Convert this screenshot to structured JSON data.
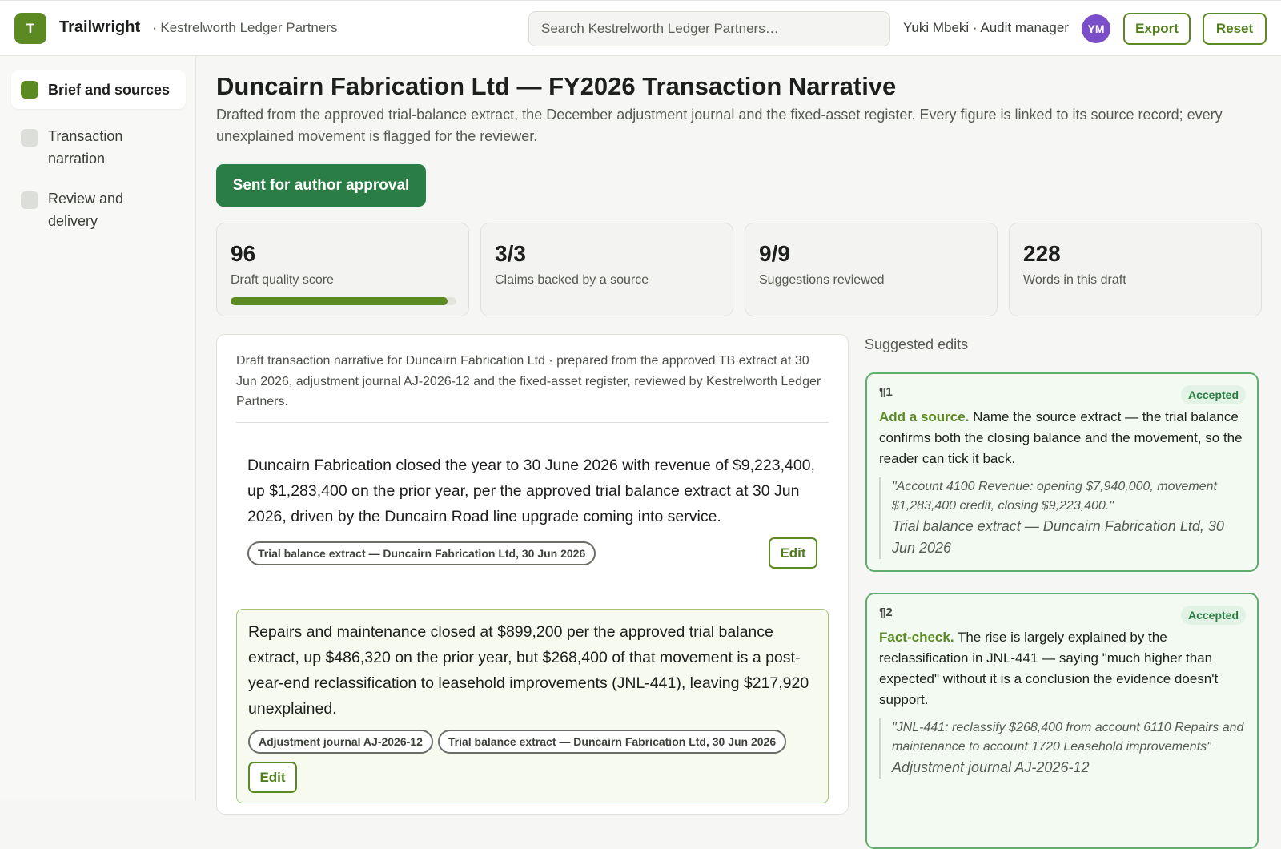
{
  "app": {
    "logo_letter": "T",
    "name": "Trailwright",
    "org": "· Kestrelworth Ledger Partners",
    "search_placeholder": "Search Kestrelworth Ledger Partners…",
    "user": "Yuki Mbeki · Audit manager",
    "avatar_initials": "YM",
    "export_label": "Export",
    "reset_label": "Reset"
  },
  "sidebar": {
    "items": [
      {
        "label": "Brief and sources",
        "active": true
      },
      {
        "label": "Transaction narration",
        "active": false
      },
      {
        "label": "Review and delivery",
        "active": false
      }
    ]
  },
  "page": {
    "title": "Duncairn Fabrication Ltd — FY2026 Transaction Narrative",
    "subtitle": "Drafted from the approved trial-balance extract, the December adjustment journal and the fixed-asset register. Every figure is linked to its source record; every unexplained movement is flagged for the reviewer.",
    "status_label": "Sent for author approval"
  },
  "stats": [
    {
      "value": "96",
      "label": "Draft quality score",
      "progress": 0.96
    },
    {
      "value": "3/3",
      "label": "Claims backed by a source"
    },
    {
      "value": "9/9",
      "label": "Suggestions reviewed"
    },
    {
      "value": "228",
      "label": "Words in this draft"
    }
  ],
  "draft": {
    "meta": "Draft transaction narrative for Duncairn Fabrication Ltd · prepared from the approved TB extract at 30 Jun 2026, adjustment journal AJ-2026-12 and the fixed-asset register, reviewed by Kestrelworth Ledger Partners.",
    "paragraphs": [
      {
        "text": "Duncairn Fabrication closed the year to 30 June 2026 with revenue of $9,223,400, up $1,283,400 on the prior year, per the approved trial balance extract at 30 Jun 2026, driven by the Duncairn Road line upgrade coming into service.",
        "sources": [
          "Trial balance extract — Duncairn Fabrication Ltd, 30 Jun 2026"
        ],
        "edit_label": "Edit"
      },
      {
        "text": "Repairs and maintenance closed at $899,200 per the approved trial balance extract, up $486,320 on the prior year, but $268,400 of that movement is a post-year-end reclassification to leasehold improvements (JNL-441), leaving $217,920 unexplained.",
        "sources": [
          "Adjustment journal AJ-2026-12",
          "Trial balance extract — Duncairn Fabrication Ltd, 30 Jun 2026"
        ],
        "edit_label": "Edit"
      }
    ]
  },
  "suggestions": {
    "heading": "Suggested edits",
    "items": [
      {
        "para": "¶1",
        "status": "Accepted",
        "kind": "Add a source.",
        "body": "Name the source extract — the trial balance confirms both the closing balance and the movement, so the reader can tick it back.",
        "quote": "\"Account 4100 Revenue: opening $7,940,000, movement $1,283,400 credit, closing $9,223,400.\"",
        "quote_source": "Trial balance extract — Duncairn Fabrication Ltd, 30 Jun 2026"
      },
      {
        "para": "¶2",
        "status": "Accepted",
        "kind": "Fact-check.",
        "body": "The rise is largely explained by the reclassification in JNL-441 — saying \"much higher than expected\" without it is a conclusion the evidence doesn't support.",
        "quote": "\"JNL-441: reclassify $268,400 from account 6110 Repairs and maintenance to account 1720 Leasehold improvements\"",
        "quote_source": "Adjustment journal AJ-2026-12"
      }
    ]
  },
  "colors": {
    "brand_green": "#5c8a22",
    "status_green": "#2a7d45",
    "accepted_border": "#5fae6e",
    "avatar_purple": "#7a4ec8"
  }
}
